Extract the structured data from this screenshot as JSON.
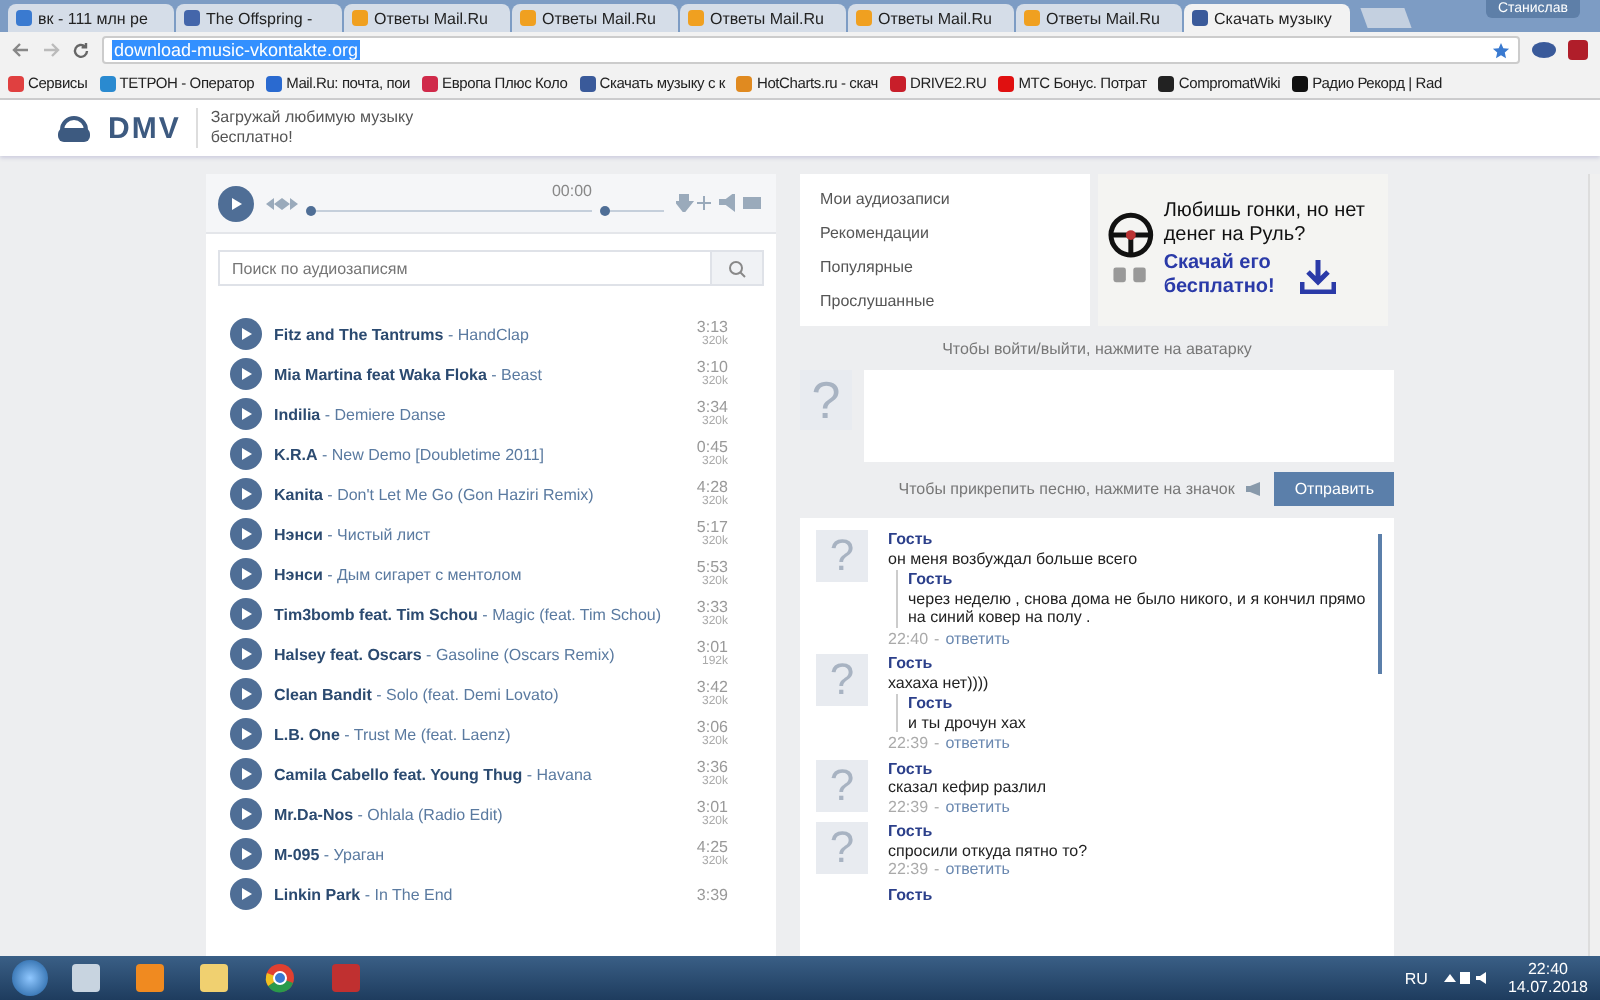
{
  "browser": {
    "tabs": [
      {
        "title": "вк - 111 млн ре",
        "selected": false
      },
      {
        "title": "The Offspring -",
        "selected": false
      },
      {
        "title": "Ответы Mail.Ru",
        "selected": false
      },
      {
        "title": "Ответы Mail.Ru",
        "selected": false
      },
      {
        "title": "Ответы Mail.Ru",
        "selected": false
      },
      {
        "title": "Ответы Mail.Ru",
        "selected": false
      },
      {
        "title": "Ответы Mail.Ru",
        "selected": false
      },
      {
        "title": "Скачать музыку",
        "selected": true
      }
    ],
    "user": "Станислав",
    "url": "download-music-vkontakte.org",
    "bookmarks": [
      {
        "label": "Сервисы",
        "color": "#e04040"
      },
      {
        "label": "ТЕТРОН - Оператор",
        "color": "#2a8ad0"
      },
      {
        "label": "Mail.Ru: почта, пои",
        "color": "#2a6ad0"
      },
      {
        "label": "Европа Плюс Коло",
        "color": "#d02a4a"
      },
      {
        "label": "Скачать музыку с к",
        "color": "#3a5a9a"
      },
      {
        "label": "HotCharts.ru - скач",
        "color": "#e08a20"
      },
      {
        "label": "DRIVE2.RU",
        "color": "#c81e2a"
      },
      {
        "label": "МТС Бонус. Потрат",
        "color": "#e01010"
      },
      {
        "label": "CompromatWiki",
        "color": "#222222"
      },
      {
        "label": "Радио Рекорд | Rad",
        "color": "#111111"
      }
    ]
  },
  "header": {
    "logo": "DMV",
    "tagline": "Загружай любимую музыку бесплатно!"
  },
  "player": {
    "time": "00:00",
    "progress": {
      "level": 0
    },
    "volume": {
      "level": 0
    }
  },
  "search": {
    "placeholder": "Поиск по аудиозаписям"
  },
  "tracks": [
    {
      "name": "**Fitz and The Tantrums** - HandClap",
      "duration": "3:13",
      "bitrate": "320k"
    },
    {
      "name": "**Mia Martina feat Waka Floka** - Beast",
      "duration": "3:10",
      "bitrate": "320k"
    },
    {
      "name": "**Indilia** - Demiere Danse",
      "duration": "3:34",
      "bitrate": "320k"
    },
    {
      "name": "**K.R.A** - New Demo [Doubletime 2011]",
      "duration": "0:45",
      "bitrate": "320k"
    },
    {
      "name": "**Kanita** - Don't Let Me Go (Gon Haziri Remix)",
      "duration": "4:28",
      "bitrate": "320k"
    },
    {
      "name": "**Нэнси** - Чистый лист",
      "duration": "5:17",
      "bitrate": "320k"
    },
    {
      "name": "**Нэнси** - Дым сигарет с ментолом",
      "duration": "5:53",
      "bitrate": "320k"
    },
    {
      "name": "**Tim3bomb feat. Tim Schou** - Magic (feat. Tim Schou)",
      "duration": "3:33",
      "bitrate": "320k"
    },
    {
      "name": "**Halsey feat. Oscars** - Gasoline (Oscars Remix)",
      "duration": "3:01",
      "bitrate": "192k"
    },
    {
      "name": "**Clean Bandit** - Solo (feat. Demi Lovato)",
      "duration": "3:42",
      "bitrate": "320k"
    },
    {
      "name": "**L.B. One** - Trust Me (feat. Laenz)",
      "duration": "3:06",
      "bitrate": "320k"
    },
    {
      "name": "**Camila Cabello feat. Young Thug** - Havana",
      "duration": "3:36",
      "bitrate": "320k"
    },
    {
      "name": "**Mr.Da-Nos** - Ohlala (Radio Edit)",
      "duration": "3:01",
      "bitrate": "320k"
    },
    {
      "name": "**M-095** - Ураган",
      "duration": "4:25",
      "bitrate": "320k"
    },
    {
      "name": "**Linkin Park** - In The End",
      "duration": "3:39"
    }
  ],
  "menu": [
    "Мои аудиозаписи",
    "Рекомендации",
    "Популярные",
    "Прослушанные"
  ],
  "ad": {
    "headline": "Любишь гонки, но нет денег на Руль?",
    "cta": "Скачай его бесплатно!"
  },
  "login_hint": "Чтобы войти/выйти, нажмите на аватарку",
  "compose": {
    "avatar": "?",
    "hint": "Чтобы прикрепить песню, нажмите на значок",
    "send": "Отправить"
  },
  "messages": [
    {
      "avatar": "?",
      "author": "Гость",
      "text": "он меня возбуждал больше всего",
      "quote": {
        "author": "Гость",
        "text": "через неделю , снова дома не было никого, и я кончил прямо на синий ковер на полу ."
      },
      "time": "22:40",
      "separator": "-",
      "reply": "ответить"
    },
    {
      "avatar": "?",
      "author": "Гость",
      "text": "хахаха нет))))",
      "quote": {
        "author": "Гость",
        "text": "и ты дрочун хах"
      },
      "time": "22:39",
      "separator": "-",
      "reply": "ответить"
    },
    {
      "avatar": "?",
      "author": "Гость",
      "text": "сказал кефир разлил",
      "time": "22:39",
      "separator": "-",
      "reply": "ответить"
    },
    {
      "avatar": "?",
      "author": "Гость",
      "text": "спросили откуда пятно то?",
      "time": "22:39",
      "separator": "-",
      "reply": "ответить"
    },
    {
      "author": "Гость"
    }
  ],
  "taskbar": {
    "lang": "RU",
    "time": "22:40",
    "date": "14.07.2018"
  }
}
